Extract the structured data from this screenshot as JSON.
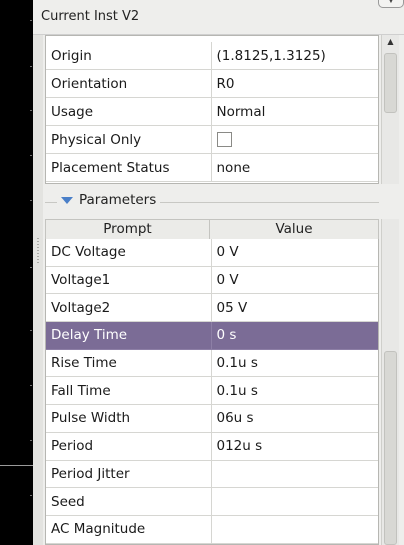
{
  "window": {
    "title": "Current Inst V2"
  },
  "properties": {
    "rows": [
      {
        "label": "Origin",
        "value": "(1.8125,1.3125)"
      },
      {
        "label": "Orientation",
        "value": "R0"
      },
      {
        "label": "Usage",
        "value": "Normal"
      },
      {
        "label": "Physical Only",
        "value": ""
      },
      {
        "label": "Placement Status",
        "value": "none"
      }
    ],
    "physical_only_checked": false
  },
  "parameters": {
    "group_label": "Parameters",
    "headers": {
      "prompt": "Prompt",
      "value": "Value"
    },
    "selected_row": "Delay Time",
    "rows": [
      {
        "label": "DC Voltage",
        "value": "0 V"
      },
      {
        "label": "Voltage1",
        "value": "0 V"
      },
      {
        "label": "Voltage2",
        "value": "05 V"
      },
      {
        "label": "Delay Time",
        "value": "0 s"
      },
      {
        "label": "Rise Time",
        "value": "0.1u s"
      },
      {
        "label": "Fall Time",
        "value": "0.1u s"
      },
      {
        "label": "Pulse Width",
        "value": "06u s"
      },
      {
        "label": "Period",
        "value": "012u s"
      },
      {
        "label": "Period Jitter",
        "value": ""
      },
      {
        "label": "Seed",
        "value": ""
      },
      {
        "label": "AC Magnitude",
        "value": ""
      }
    ]
  },
  "colors": {
    "selection": "#7b6c96",
    "panel_bg": "#eeeeec",
    "canvas_bg": "#000000",
    "group_arrow": "#4a7fc8"
  },
  "icons": {
    "group_expander": "triangle-down-icon",
    "scroll_up": "arrow-up-icon",
    "corner_button": "chevron-down-icon"
  }
}
